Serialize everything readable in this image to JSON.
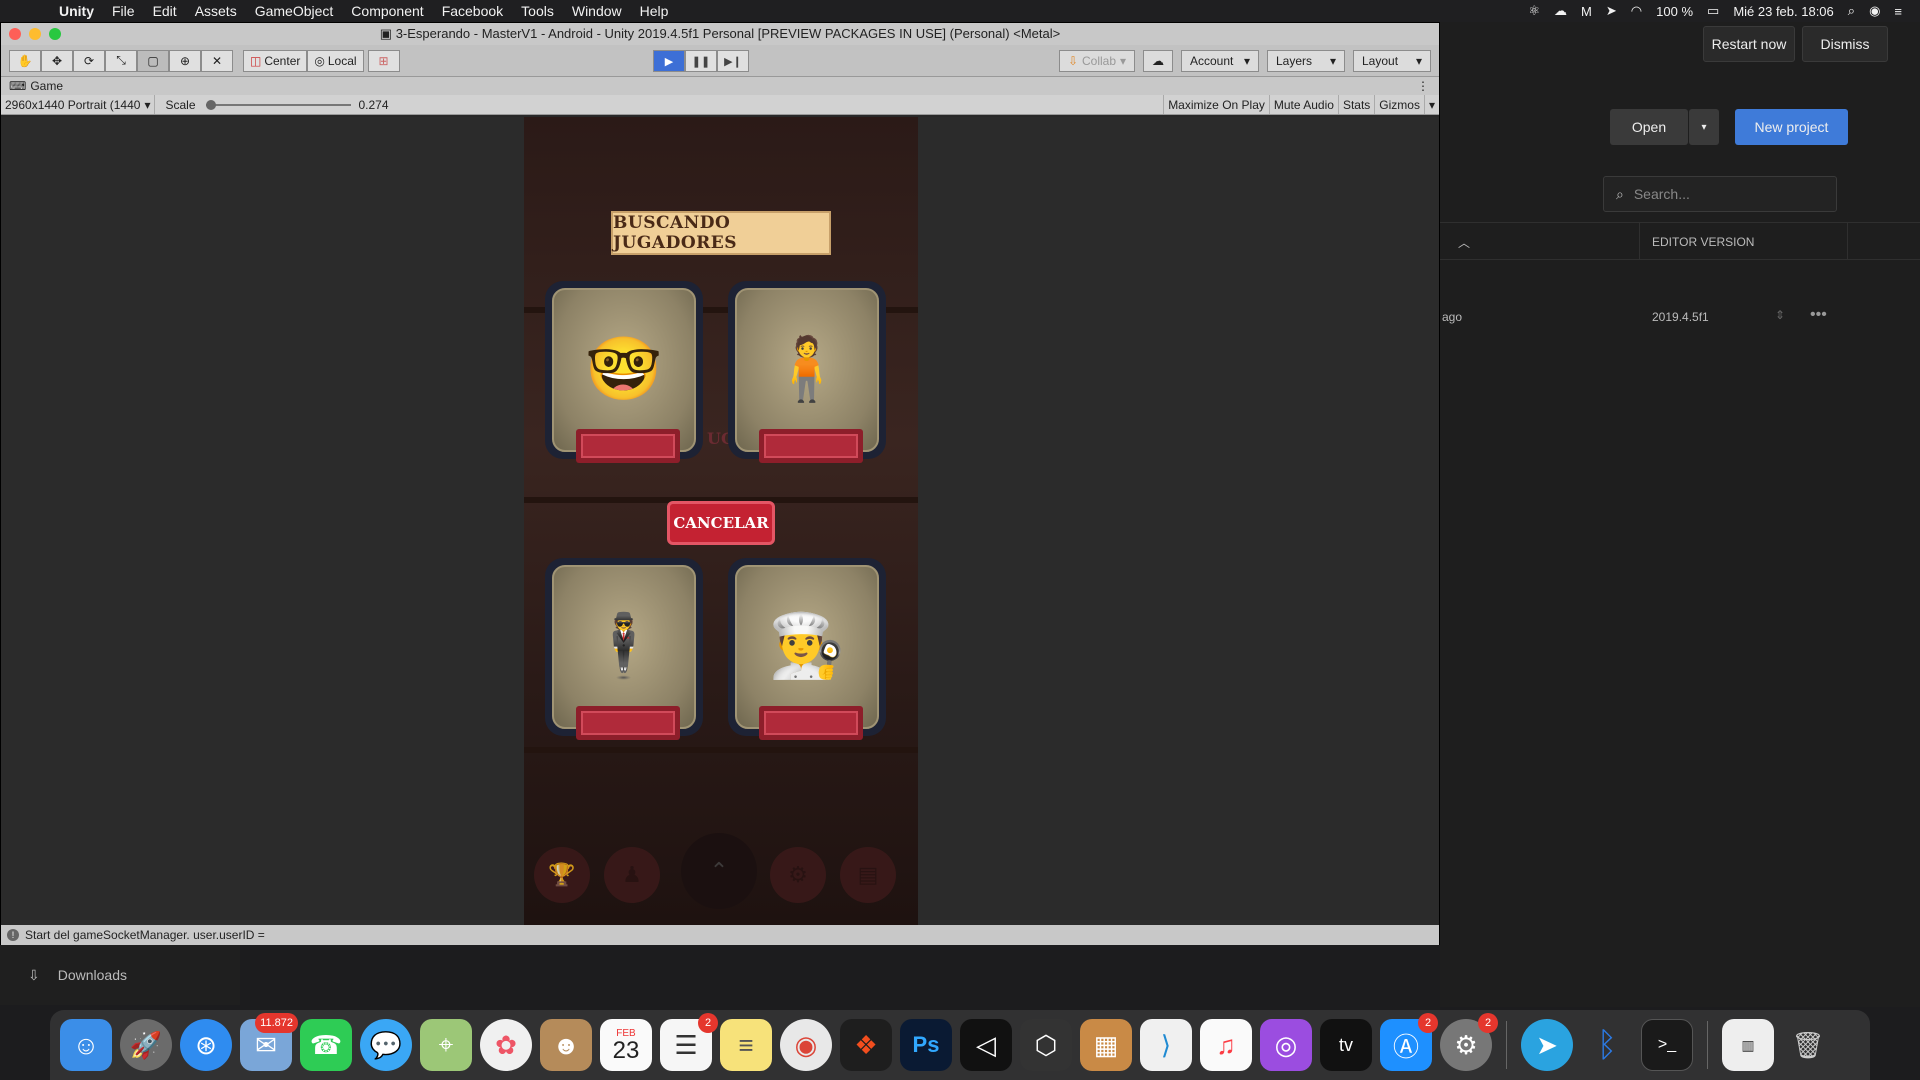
{
  "menubar": {
    "app_name": "Unity",
    "items": [
      "File",
      "Edit",
      "Assets",
      "GameObject",
      "Component",
      "Facebook",
      "Tools",
      "Window",
      "Help"
    ],
    "battery": "100 %",
    "datetime": "Mié 23 feb.  18:06"
  },
  "hub": {
    "restart_label": "Restart now",
    "dismiss_label": "Dismiss",
    "open_label": "Open",
    "new_project_label": "New project",
    "search_placeholder": "Search...",
    "col_editor_version": "EDITOR VERSION",
    "row_modified": "ago",
    "row_version": "2019.4.5f1"
  },
  "unity": {
    "window_title": "3-Esperando - MasterV1 - Android - Unity 2019.4.5f1 Personal [PREVIEW PACKAGES IN USE] (Personal) <Metal>",
    "pivot_center": "Center",
    "pivot_local": "Local",
    "collab_label": "Collab",
    "account_label": "Account",
    "layers_label": "Layers",
    "layout_label": "Layout",
    "game_tab": "Game",
    "resolution": "2960x1440 Portrait (1440",
    "scale_label": "Scale",
    "scale_value": "0.274",
    "scale_level": 0.0,
    "maximize_on_play": "Maximize On Play",
    "mute_audio": "Mute Audio",
    "stats": "Stats",
    "gizmos": "Gizmos",
    "status_message": "Start del gameSocketManager. user.userID ="
  },
  "game": {
    "title": "BUSCANDO JUGADORES",
    "hidden_text": "UG",
    "cancel_label": "CANCELAR"
  },
  "downloads_label": "Downloads",
  "dock": {
    "mail_badge": "11.872",
    "calendar_month": "FEB",
    "calendar_day": "23",
    "reminders_badge": "2",
    "appstore_badge": "2",
    "settings_badge": "2",
    "photoshop_label": "Ps",
    "appletv_label": "tv"
  },
  "colors": {
    "play_blue": "#3d6fd6",
    "hub_blue": "#3f7bd9",
    "cancel_red": "#c42232",
    "banner_gold": "#f0cf97"
  }
}
